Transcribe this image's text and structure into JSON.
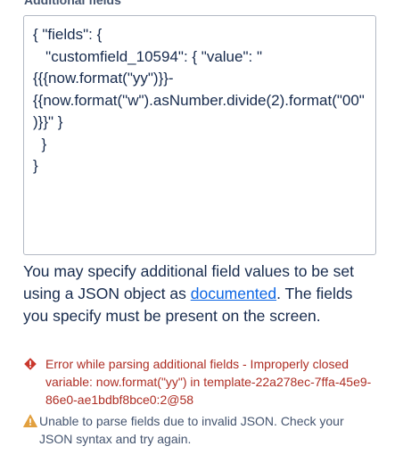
{
  "field": {
    "label": "Additional fields",
    "json_value": "{ \"fields\": {\n   \"customfield_10594\": { \"value\": \"{{{now.format(\"yy\")}}-{{now.format(\"w\").asNumber.divide(2).format(\"00\")}}\" }\n  }\n}"
  },
  "help": {
    "text_before": "You may specify additional field values to be set using a JSON object as ",
    "link_text": "documented",
    "text_after": ". The fields you specify must be present on the screen."
  },
  "error": {
    "icon": "error-diamond-icon",
    "text": "Error while parsing additional fields - Improperly closed variable: now.format(\"yy\") in template-22a278ec-7ffa-45e9-86e0-ae1bdbf8bce0:2@58",
    "color": "#ae2e24"
  },
  "warning": {
    "icon": "warning-triangle-icon",
    "text": "Unable to parse fields due to invalid JSON. Check your JSON syntax and try again.",
    "color": "#e2a03f"
  },
  "colors": {
    "link": "#0c66e4",
    "text": "#172b4d",
    "border": "#b3b9c4"
  }
}
